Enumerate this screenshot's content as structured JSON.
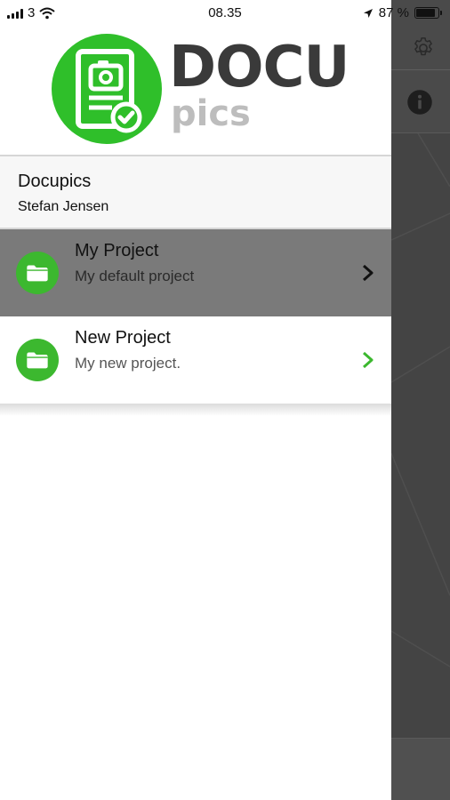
{
  "status_bar": {
    "carrier": "3",
    "time": "08.35",
    "battery": "87 %"
  },
  "logo": {
    "word": "DOCU",
    "sub": "pics"
  },
  "account": {
    "app_name": "Docupics",
    "user_name": "Stefan Jensen"
  },
  "projects": [
    {
      "title": "My Project",
      "subtitle": "My default project",
      "selected": true
    },
    {
      "title": "New Project",
      "subtitle": "My new project.",
      "selected": false
    }
  ],
  "icons": {
    "settings": "gear-icon",
    "info": "info-icon",
    "project": "folder-icon",
    "open": "chevron-right-icon"
  },
  "colors": {
    "brand_green": "#2fbf2a",
    "selected_row": "#7a7a7a",
    "chevron_green": "#3cb82f"
  }
}
